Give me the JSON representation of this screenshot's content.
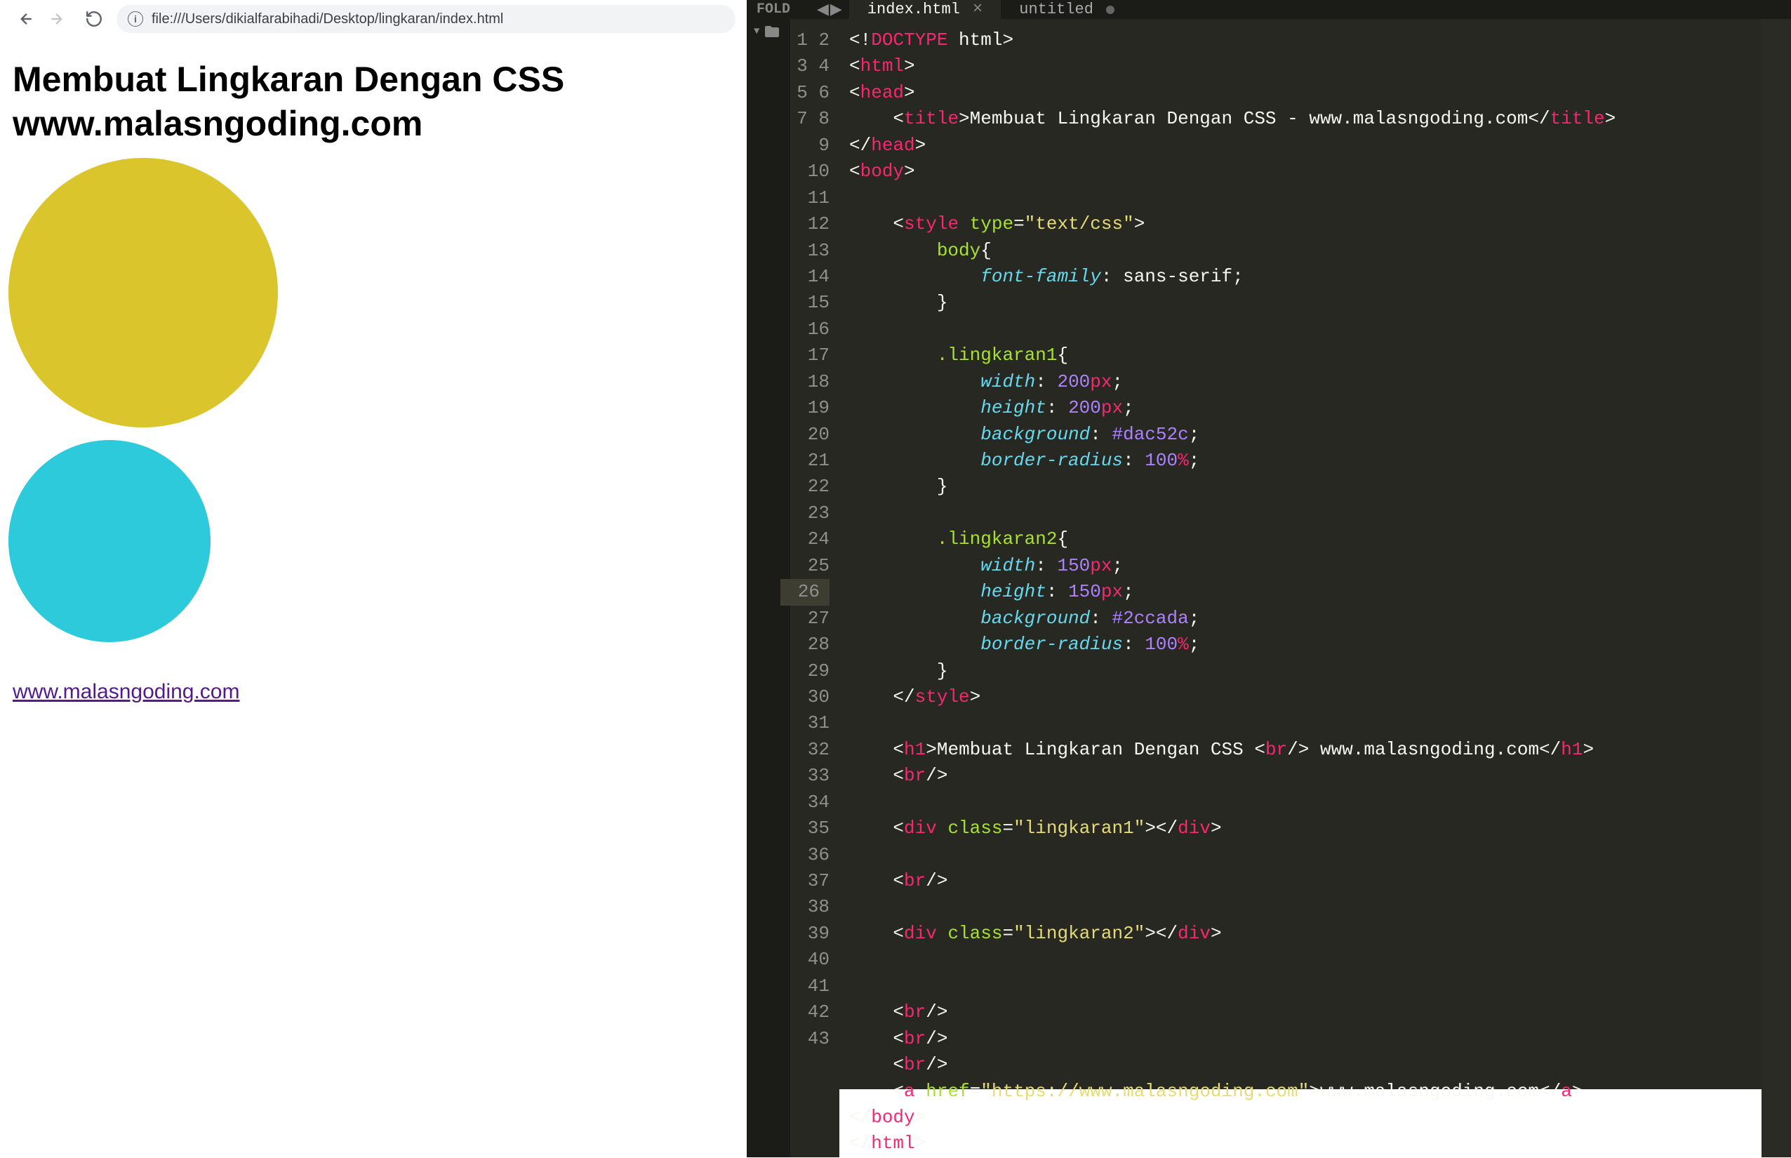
{
  "browser": {
    "url": "file:///Users/dikialfarabihadi/Desktop/lingkaran/index.html",
    "page": {
      "heading_line1": "Membuat Lingkaran Dengan CSS",
      "heading_line2": "www.malasngoding.com",
      "link_text": "www.malasngoding.com",
      "circle1_color": "#dac52c",
      "circle2_color": "#2ccada"
    }
  },
  "editor": {
    "sidebar_label": "FOLD",
    "tabs": [
      {
        "label": "index.html",
        "active": true,
        "dirty": false
      },
      {
        "label": "untitled",
        "active": false,
        "dirty": true
      }
    ],
    "line_count": 43,
    "highlighted_line": 26,
    "code": {
      "title_text": "Membuat Lingkaran Dengan CSS - www.malasngoding.com",
      "style_type": "text/css",
      "body_font": "sans-serif",
      "sel1": ".lingkaran1",
      "sel1_w": "200",
      "sel1_wu": "px",
      "sel1_h": "200",
      "sel1_hu": "px",
      "sel1_bg": "#dac52c",
      "sel1_br": "100",
      "sel1_bru": "%",
      "sel2": ".lingkaran2",
      "sel2_w": "150",
      "sel2_wu": "px",
      "sel2_h": "150",
      "sel2_hu": "px",
      "sel2_bg": "#2ccada",
      "sel2_br": "100",
      "sel2_bru": "%",
      "h1_text1": "Membuat Lingkaran Dengan CSS ",
      "h1_text2": " www.malasngoding.com",
      "div1_class": "lingkaran1",
      "div2_class": "lingkaran2",
      "a_href": "https://www.malasngoding.com",
      "a_text": "www.malasngoding.com"
    }
  }
}
